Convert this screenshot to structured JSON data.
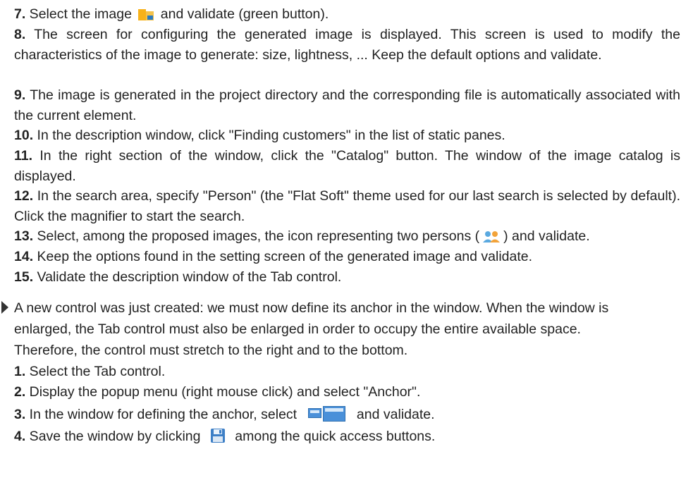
{
  "steps": [
    {
      "num": "7.",
      "pre": " Select the image ",
      "icon": "folder-image-icon",
      "post": " and validate (green button)."
    },
    {
      "num": "8.",
      "text": " The screen for configuring the generated image is displayed. This screen is used to modify the characteristics of the image to generate: size, lightness, ... Keep the default options and validate."
    },
    {
      "num": "9.",
      "text": " The image is generated in the project directory and the corresponding file is automatically associated with the current element."
    },
    {
      "num": "10.",
      "text": " In the description window, click \"Finding customers\" in the list of static panes."
    },
    {
      "num": "11.",
      "text": " In the right section of the window, click the \"Catalog\" button. The window of the image catalog is displayed."
    },
    {
      "num": "12.",
      "text": " In the search area, specify \"Person\" (the \"Flat Soft\" theme used for our last search is selected by default). Click the magnifier to start the search."
    },
    {
      "num": "13.",
      "pre": " Select, among the proposed images, the icon representing two persons (",
      "icon": "two-persons-icon",
      "post": ") and validate."
    },
    {
      "num": "14.",
      "text": " Keep the options found in the setting screen of the generated image and validate."
    },
    {
      "num": "15.",
      "text": " Validate the description window of the Tab control."
    }
  ],
  "section2": {
    "intro": "A new control was just created: we must now define its anchor in the window. When the window is enlarged, the Tab control must also be enlarged in order to occupy the entire available space. Therefore, the control must stretch to the right and to the bottom.",
    "steps": [
      {
        "num": "1.",
        "text": " Select the Tab control."
      },
      {
        "num": "2.",
        "text": " Display the popup menu (right mouse click) and select \"Anchor\"."
      },
      {
        "num": "3.",
        "pre": " In the window for defining the anchor, select ",
        "icon": "anchor-stretch-icon",
        "post": " and validate."
      },
      {
        "num": "4.",
        "pre": " Save the window by clicking ",
        "icon": "save-floppy-icon",
        "post": " among the quick access buttons."
      }
    ]
  }
}
